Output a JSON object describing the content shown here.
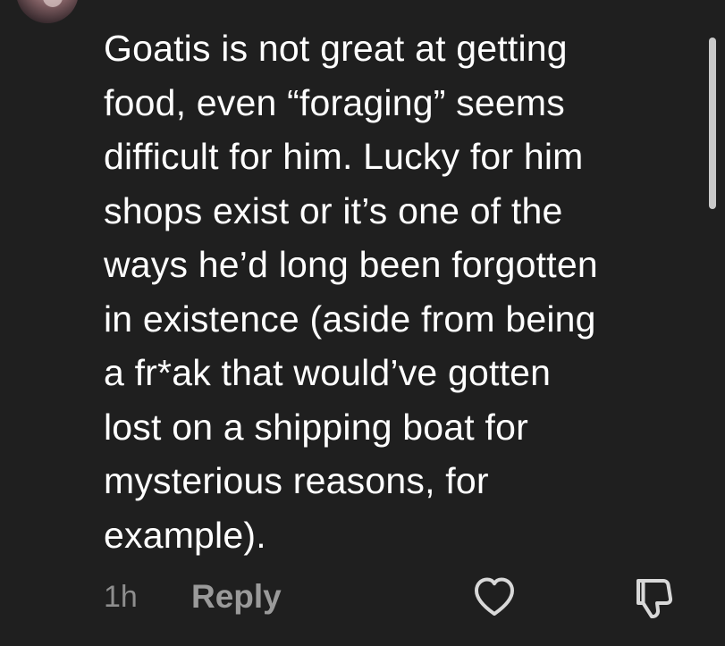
{
  "comment": {
    "lines": [
      "Goatis is not great at getting",
      "food, even “foraging” seems",
      "difficult for him. Lucky for him",
      "shops exist or it’s one of the",
      "ways he’d long been forgotten",
      "in existence (aside from being",
      "a fr*ak that would’ve gotten",
      "lost on a shipping boat for",
      "mysterious reasons, for",
      "example)."
    ],
    "timestamp": "1h",
    "reply_label": "Reply"
  },
  "icons": {
    "avatar": "user-avatar",
    "like": "heart-outline-icon",
    "dislike": "thumbs-down-outline-icon"
  },
  "colors": {
    "background": "#1f1f1f",
    "text": "#ffffff",
    "secondary_text": "#8e8e8e",
    "icon": "#d8d8d8"
  }
}
